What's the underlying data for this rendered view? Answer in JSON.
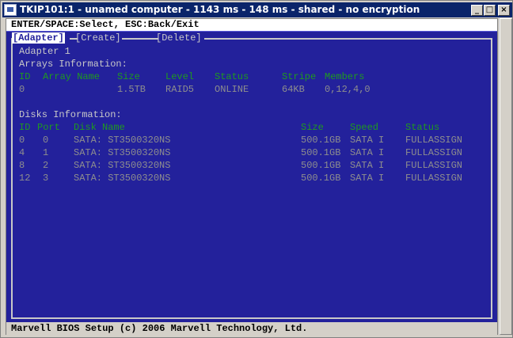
{
  "window": {
    "title": "TKIP101:1 - unamed computer - 1143 ms - 148 ms - shared - no encryption",
    "btn_min": "_",
    "btn_max": "□",
    "btn_close": "×"
  },
  "help_bar": "ENTER/SPACE:Select, ESC:Back/Exit",
  "tabs": [
    "[Adapter]",
    "[Create]",
    "[Delete]"
  ],
  "adapter_heading": "Adapter 1",
  "arrays": {
    "section": "Arrays Information:",
    "headers": [
      "ID",
      "Array Name",
      "Size",
      "Level",
      "Status",
      "Stripe",
      "Members"
    ],
    "rows": [
      [
        "0",
        "",
        "1.5TB",
        "RAID5",
        "ONLINE",
        "64KB",
        "0,12,4,0"
      ]
    ]
  },
  "disks": {
    "section": "Disks Information:",
    "headers": [
      "ID",
      "Port",
      "Disk Name",
      "Size",
      "Speed",
      "Status"
    ],
    "rows": [
      [
        "0",
        "0",
        "SATA: ST3500320NS",
        "500.1GB",
        "SATA I",
        "FULLASSIGN"
      ],
      [
        "4",
        "1",
        "SATA: ST3500320NS",
        "500.1GB",
        "SATA I",
        "FULLASSIGN"
      ],
      [
        "8",
        "2",
        "SATA: ST3500320NS",
        "500.1GB",
        "SATA I",
        "FULLASSIGN"
      ],
      [
        "12",
        "3",
        "SATA: ST3500320NS",
        "500.1GB",
        "SATA I",
        "FULLASSIGN"
      ]
    ]
  },
  "status_bar": "Marvell BIOS Setup (c) 2006 Marvell Technology, Ltd.",
  "colors": {
    "screen_bg": "#23219b",
    "header_green": "#1f9a1f",
    "data_gray": "#8e8e8e",
    "titlebar": "#0a246a"
  }
}
